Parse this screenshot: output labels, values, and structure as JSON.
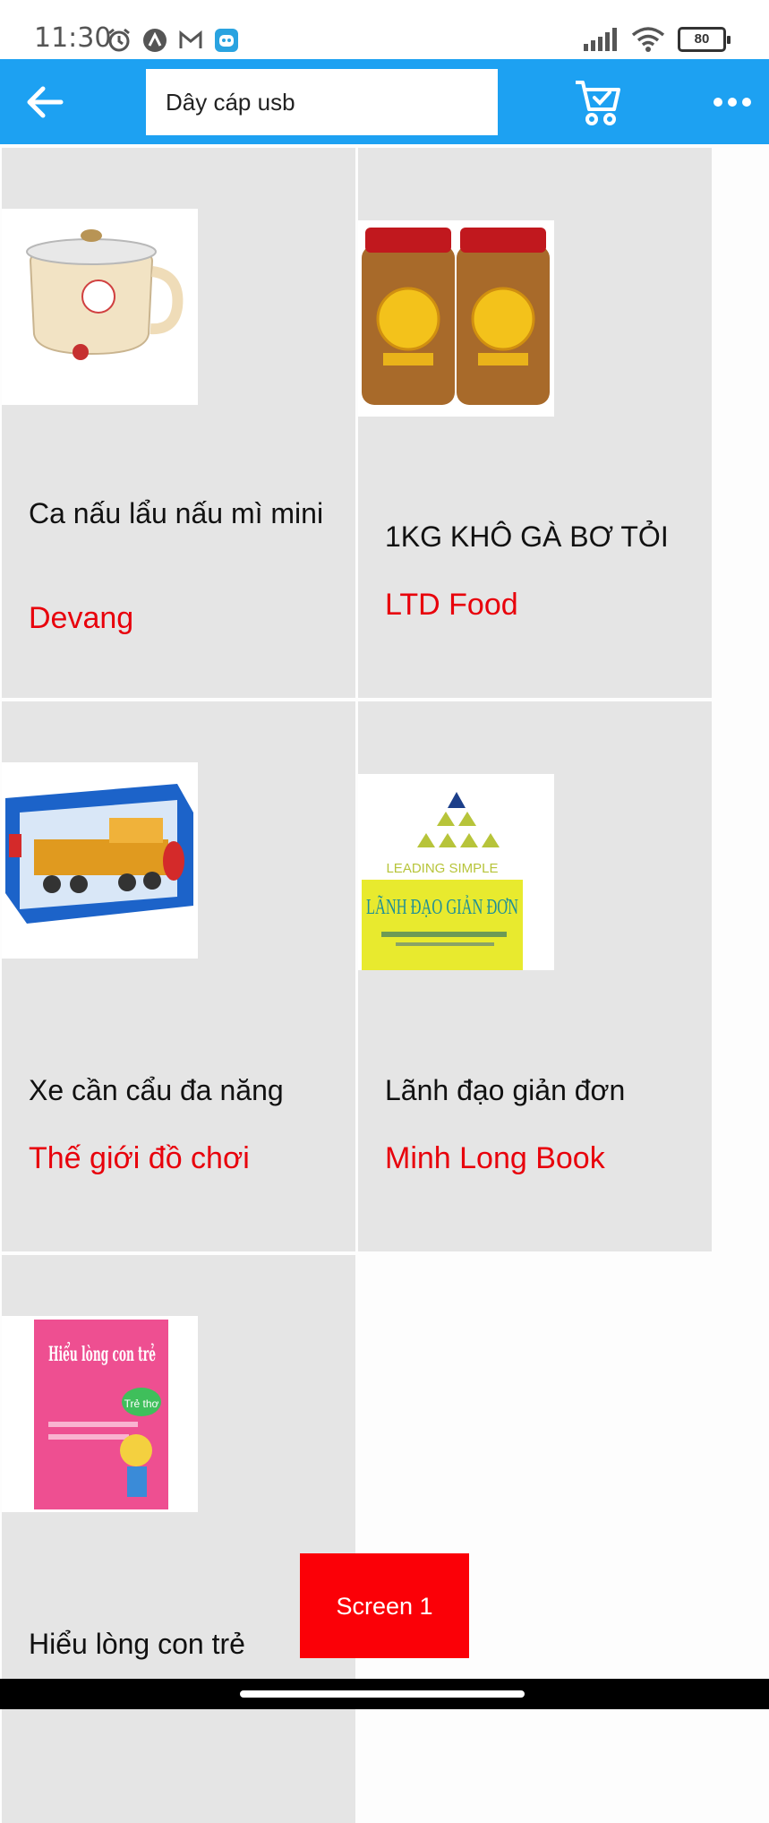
{
  "status_bar": {
    "time": "11:30",
    "battery": "80",
    "left_icons": [
      "alarm-icon",
      "app-a-icon",
      "gmail-icon",
      "robot-app-icon"
    ],
    "right_icons": [
      "signal-icon",
      "wifi-icon",
      "battery-icon"
    ]
  },
  "app_bar": {
    "search_value": "Dây cáp usb",
    "color": "#1da1f2",
    "icons": [
      "back-arrow-icon",
      "cart-check-icon",
      "more-dots-icon"
    ]
  },
  "products": [
    {
      "title": "Ca nấu lẩu nấu mì mini",
      "seller": "Devang",
      "image": "electric-pot-image"
    },
    {
      "title": "1KG KHÔ GÀ BƠ TỎI",
      "seller": "LTD Food",
      "image": "dried-chicken-jars-image"
    },
    {
      "title": "Xe cần cẩu đa năng",
      "seller": "Thế giới đồ chơi",
      "image": "toy-crane-truck-image"
    },
    {
      "title": "Lãnh đạo giản đơn",
      "seller": "Minh Long Book",
      "image": "leading-simple-book-image"
    },
    {
      "title": "Hiểu lòng con trẻ",
      "seller": "",
      "image": "hieu-long-con-tre-book-image"
    }
  ],
  "book_cover_1": {
    "top": "LEADING SIMPLE",
    "main": "LÃNH ĐẠO GIẢN ĐƠN"
  },
  "book_cover_2": {
    "main": "Hiểu lòng con trẻ",
    "badge": "Trẻ thơ"
  },
  "screen_button": "Screen 1",
  "colors": {
    "accent": "#1da1f2",
    "seller": "#e8000b",
    "card": "#e5e5e5",
    "button": "#fb0007"
  }
}
